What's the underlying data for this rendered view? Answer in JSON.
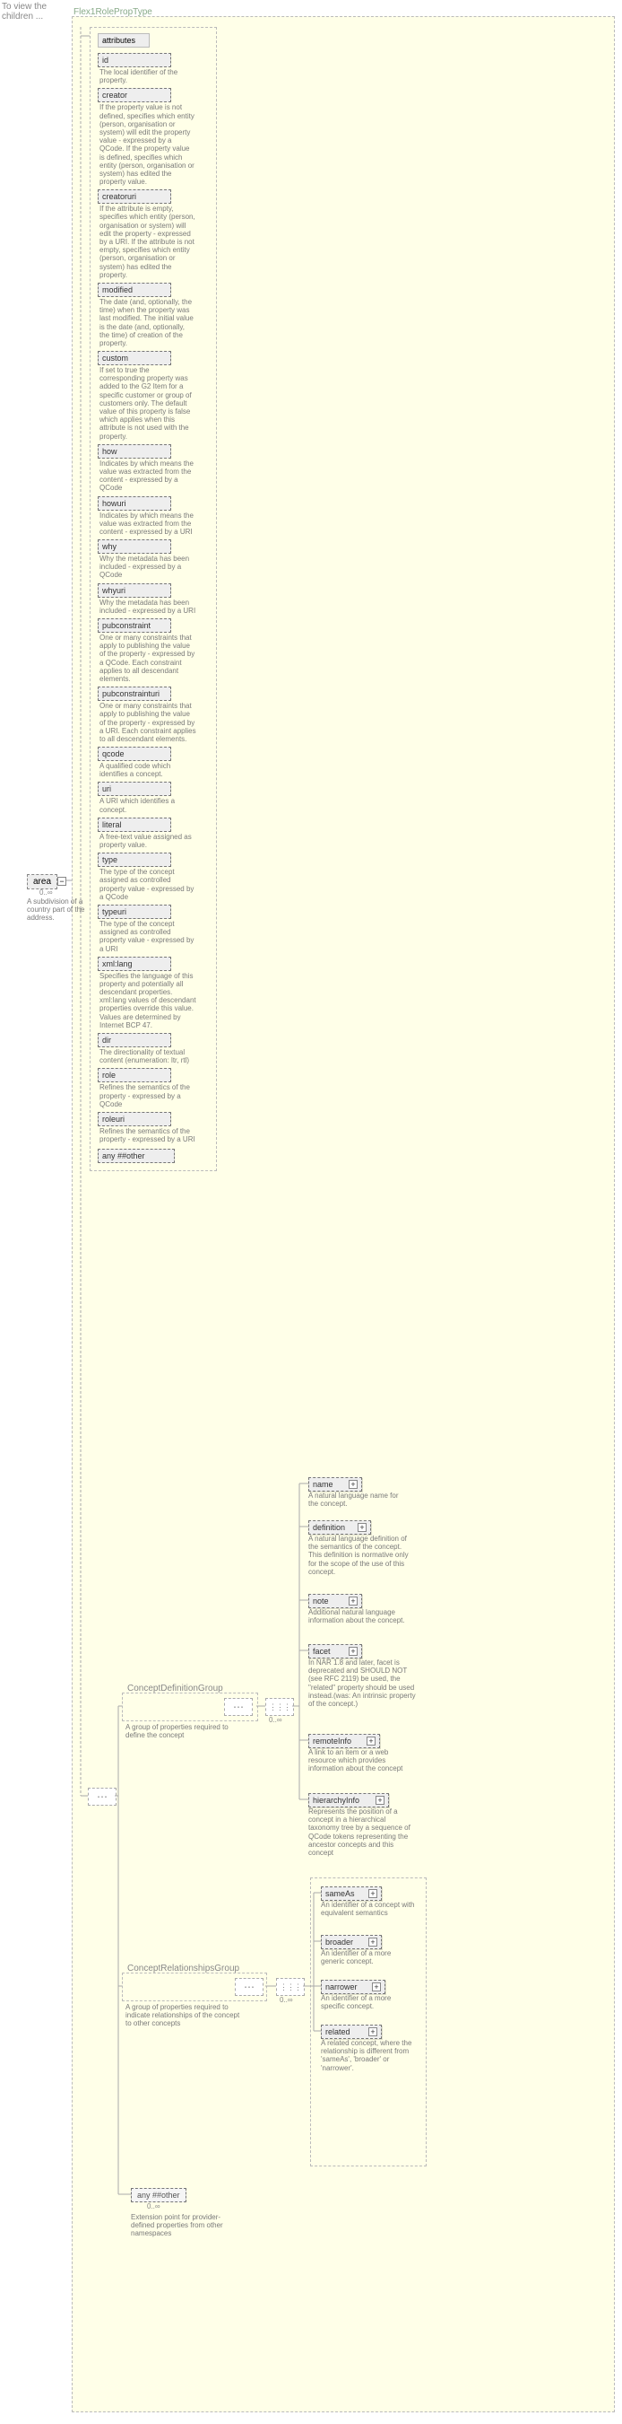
{
  "labels": {
    "treeHint": "To view the children ...",
    "typeTitle": "Flex1RolePropType"
  },
  "source": {
    "name": "area",
    "card": "0..∞",
    "desc": "A subdivision of a country part of the address."
  },
  "attributesHeader": "attributes",
  "attrs": [
    {
      "name": "id",
      "desc": "The local identifier of the property."
    },
    {
      "name": "creator",
      "desc": "If the property value is not defined, specifies which entity (person, organisation or system) will edit the property value - expressed by a QCode. If the property value is defined, specifies which entity (person, organisation or system) has edited the property value."
    },
    {
      "name": "creatoruri",
      "desc": "If the attribute is empty, specifies which entity (person, organisation or system) will edit the property - expressed by a URI. If the attribute is not empty, specifies which entity (person, organisation or system) has edited the property."
    },
    {
      "name": "modified",
      "desc": "The date (and, optionally, the time) when the property was last modified. The initial value is the date (and, optionally, the time) of creation of the property."
    },
    {
      "name": "custom",
      "desc": "If set to true the corresponding property was added to the G2 Item for a specific customer or group of customers only. The default value of this property is false which applies when this attribute is not used with the property."
    },
    {
      "name": "how",
      "desc": "Indicates by which means the value was extracted from the content - expressed by a QCode"
    },
    {
      "name": "howuri",
      "desc": "Indicates by which means the value was extracted from the content - expressed by a URI"
    },
    {
      "name": "why",
      "desc": "Why the metadata has been included - expressed by a QCode"
    },
    {
      "name": "whyuri",
      "desc": "Why the metadata has been included - expressed by a URI"
    },
    {
      "name": "pubconstraint",
      "desc": "One or many constraints that apply to publishing the value of the property - expressed by a QCode. Each constraint applies to all descendant elements."
    },
    {
      "name": "pubconstrainturi",
      "desc": "One or many constraints that apply to publishing the value of the property - expressed by a URI. Each constraint applies to all descendant elements."
    },
    {
      "name": "qcode",
      "desc": "A qualified code which identifies a concept."
    },
    {
      "name": "uri",
      "desc": "A URI which identifies a concept."
    },
    {
      "name": "literal",
      "desc": "A free-text value assigned as property value."
    },
    {
      "name": "type",
      "desc": "The type of the concept assigned as controlled property value - expressed by a QCode"
    },
    {
      "name": "typeuri",
      "desc": "The type of the concept assigned as controlled property value - expressed by a URI"
    },
    {
      "name": "xml:lang",
      "desc": "Specifies the language of this property and potentially all descendant properties. xml:lang values of descendant properties override this value. Values are determined by Internet BCP 47."
    },
    {
      "name": "dir",
      "desc": "The directionality of textual content (enumeration: ltr, rtl)"
    },
    {
      "name": "role",
      "desc": "Refines the semantics of the property - expressed by a QCode"
    },
    {
      "name": "roleuri",
      "desc": "Refines the semantics of the property - expressed by a URI"
    }
  ],
  "anyOtherAttr": "any ##other",
  "defGroup": {
    "title": "ConceptDefinitionGroup",
    "desc": "A group of properties required to define the concept",
    "card": "0..∞",
    "items": [
      {
        "name": "name",
        "desc": "A natural language name for the concept."
      },
      {
        "name": "definition",
        "desc": "A natural language definition of the semantics of the concept. This definition is normative only for the scope of the use of this concept."
      },
      {
        "name": "note",
        "desc": "Additional natural language information about the concept."
      },
      {
        "name": "facet",
        "desc": "In NAR 1.8 and later, facet is deprecated and SHOULD NOT (see RFC 2119) be used, the \"related\" property should be used instead.(was: An intrinsic property of the concept.)"
      },
      {
        "name": "remoteInfo",
        "desc": "A link to an item or a web resource which provides information about the concept"
      },
      {
        "name": "hierarchyInfo",
        "desc": "Represents the position of a concept in a hierarchical taxonomy tree by a sequence of QCode tokens representing the ancestor concepts and this concept"
      }
    ]
  },
  "relGroup": {
    "title": "ConceptRelationshipsGroup",
    "desc": "A group of properties required to indicate relationships of the concept to other concepts",
    "card": "0..∞",
    "items": [
      {
        "name": "sameAs",
        "desc": "An identifier of a concept with equivalent semantics"
      },
      {
        "name": "broader",
        "desc": "An identifier of a more generic concept."
      },
      {
        "name": "narrower",
        "desc": "An identifier of a more specific concept."
      },
      {
        "name": "related",
        "desc": "A related concept, where the relationship is different from 'sameAs', 'broader' or 'narrower'."
      }
    ]
  },
  "anyOther": {
    "label": "any ##other",
    "card": "0..∞",
    "desc": "Extension point for provider-defined properties from other namespaces"
  }
}
